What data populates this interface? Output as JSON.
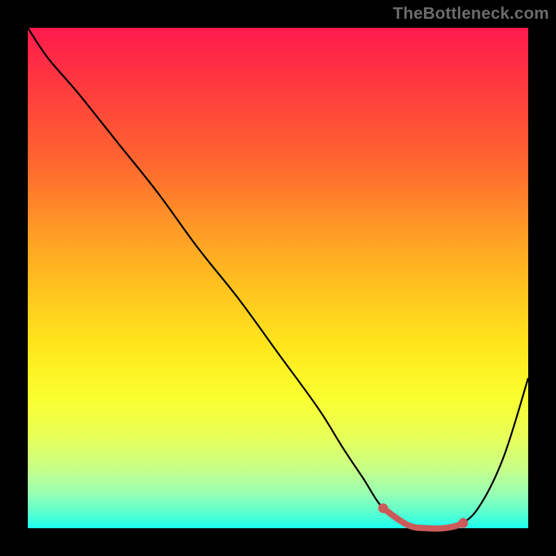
{
  "watermark": "TheBottleneck.com",
  "colors": {
    "background": "#000000",
    "curve_stroke": "#000000",
    "marker_stroke": "#cc5a5a",
    "marker_fill": "#cc5a5a"
  },
  "chart_data": {
    "type": "line",
    "title": "",
    "xlabel": "",
    "ylabel": "",
    "xlim": [
      0,
      100
    ],
    "ylim": [
      0,
      100
    ],
    "grid": false,
    "series": [
      {
        "name": "curve",
        "x": [
          0,
          4,
          10,
          18,
          26,
          34,
          42,
          50,
          58,
          63,
          67,
          71,
          76,
          80,
          83,
          86,
          90,
          95,
          100
        ],
        "y": [
          100,
          94,
          87,
          77,
          67,
          56,
          46,
          35,
          24,
          16,
          10,
          4,
          0.6,
          0,
          0,
          0.6,
          4,
          14,
          30
        ]
      }
    ],
    "highlight_segment": {
      "start_x": 71,
      "end_x": 87
    },
    "markers": [
      {
        "x": 71,
        "y": 4
      },
      {
        "x": 87,
        "y": 1
      }
    ]
  }
}
